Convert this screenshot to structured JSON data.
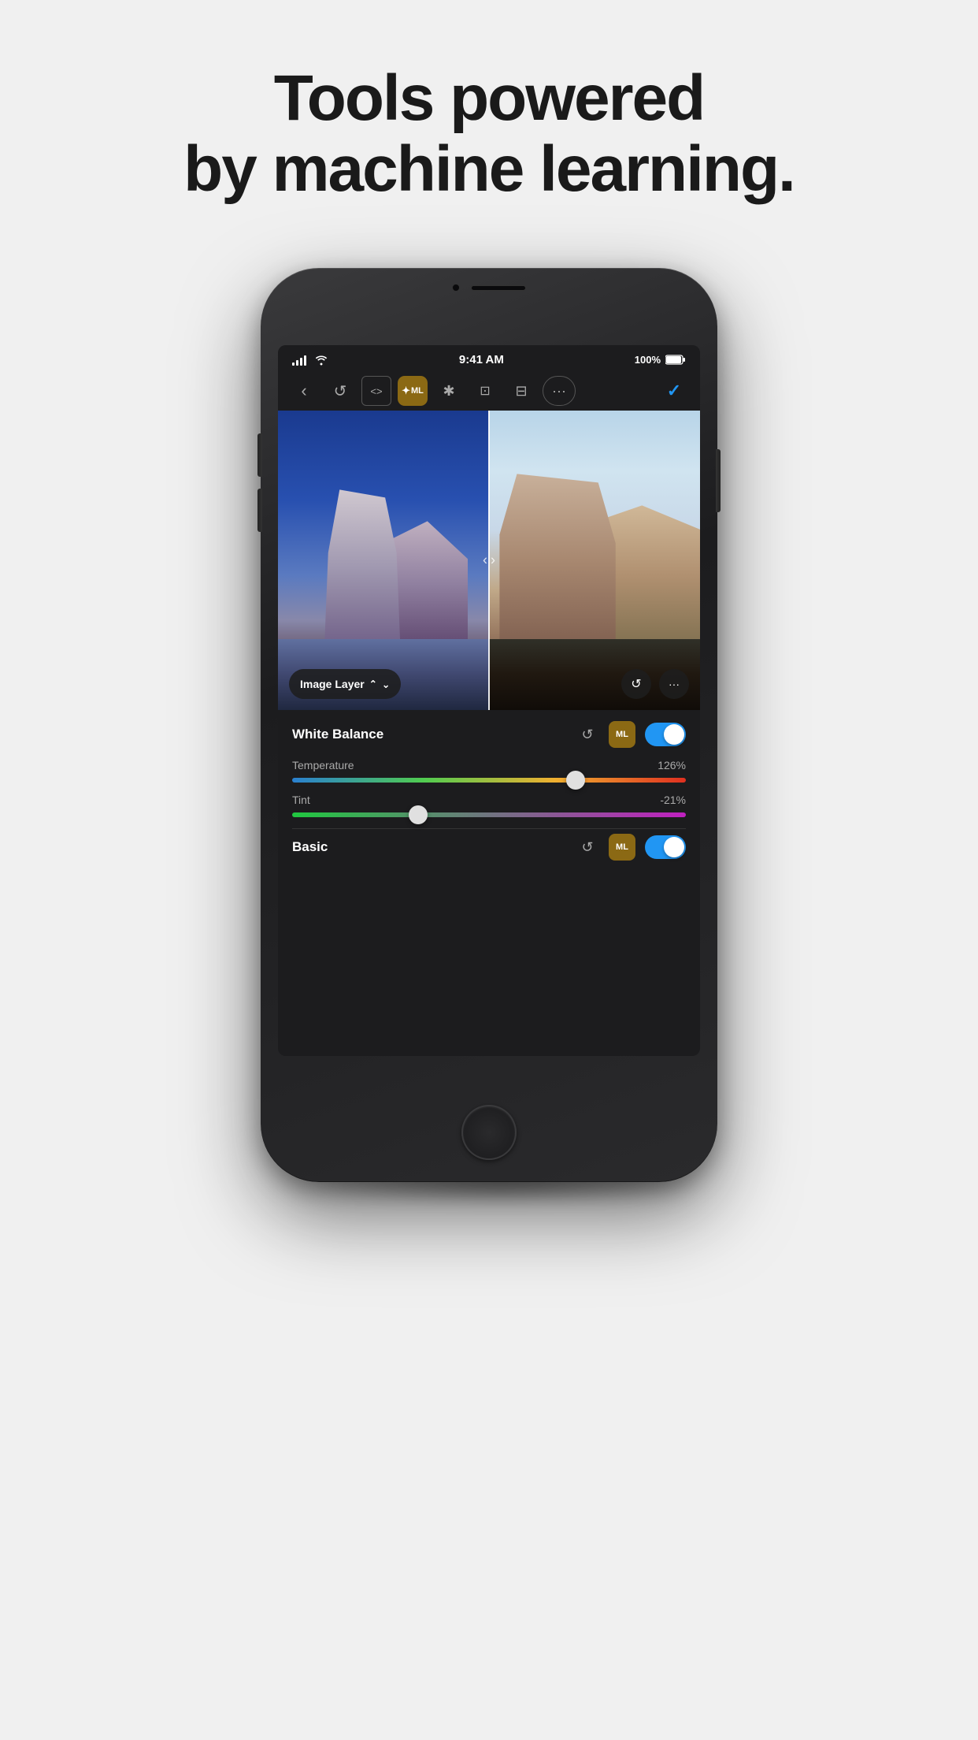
{
  "headline": {
    "line1": "Tools powered",
    "line2": "by machine learning."
  },
  "status_bar": {
    "time": "9:41 AM",
    "battery": "100%"
  },
  "toolbar": {
    "back_label": "‹",
    "undo_label": "↺",
    "code_label": "<>",
    "ml_label": "ML",
    "heal_label": "✦",
    "crop_label": "⊡",
    "adjust_label": "≡",
    "more_label": "···",
    "check_label": "✓"
  },
  "image_area": {
    "layer_button": "Image Layer",
    "left_arrow": "‹",
    "right_arrow": "›"
  },
  "white_balance": {
    "title": "White Balance",
    "ml_label": "ML",
    "temperature_label": "Temperature",
    "temperature_value": "126%",
    "temperature_percent": 72,
    "tint_label": "Tint",
    "tint_value": "-21%",
    "tint_percent": 32
  },
  "basic": {
    "title": "Basic",
    "ml_label": "ML"
  }
}
